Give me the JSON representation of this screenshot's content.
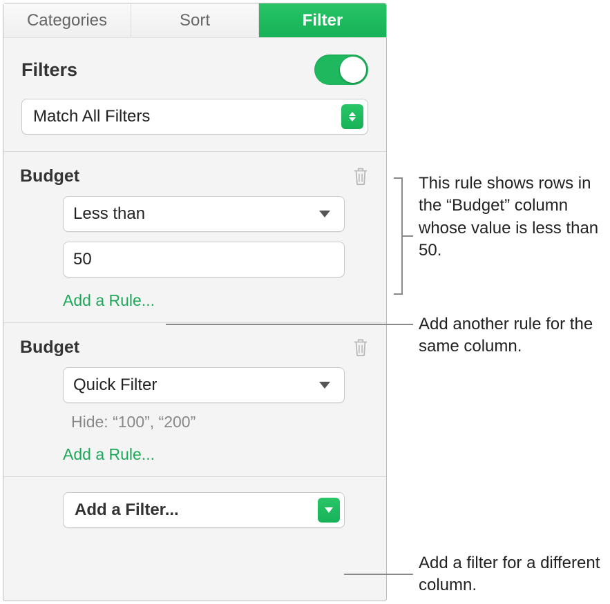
{
  "tabs": {
    "categories": "Categories",
    "sort": "Sort",
    "filter": "Filter"
  },
  "header": {
    "title": "Filters"
  },
  "match": {
    "label": "Match All Filters"
  },
  "groups": [
    {
      "title": "Budget",
      "condition": "Less than",
      "value": "50",
      "add_rule": "Add a Rule..."
    },
    {
      "title": "Budget",
      "condition": "Quick Filter",
      "hide_text": "Hide: “100”, “200”",
      "add_rule": "Add a Rule..."
    }
  ],
  "add_filter": {
    "label": "Add a Filter..."
  },
  "callouts": {
    "rule_desc": "This rule shows rows in the “Budget” column whose value is less than 50.",
    "same_col": "Add another rule for the same column.",
    "diff_col": "Add a filter for a different column."
  }
}
